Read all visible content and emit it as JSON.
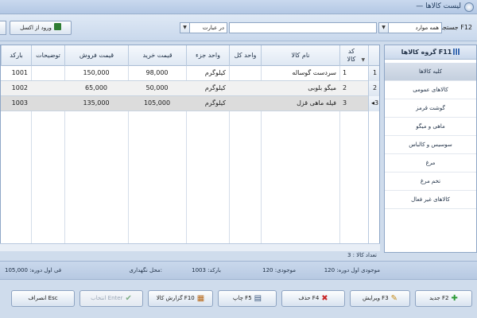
{
  "window": {
    "title": "— لیست کالاها"
  },
  "toolbar": {
    "search_label": "جستجو F12",
    "field_select": "همه موارد",
    "mode_select": "در عبارت",
    "search_value": "",
    "excel_button": "ورود از اکسل"
  },
  "grid": {
    "columns": {
      "code": "کد کالا",
      "name": "نام کالا",
      "unit_whole": "واحد کل",
      "unit_part": "واحد جزء",
      "buy_price": "قیمت خرید",
      "sell_price": "قیمت فروش",
      "description": "توضیحات",
      "barcode": "بارکد"
    },
    "rows": [
      {
        "index": "1",
        "code": "1",
        "name": "سردست گوساله",
        "unit_whole": "",
        "unit_part": "کیلوگرم",
        "buy_price": "98,000",
        "sell_price": "150,000",
        "description": "",
        "barcode": "1001"
      },
      {
        "index": "2",
        "code": "2",
        "name": "میگو بلوبی",
        "unit_whole": "",
        "unit_part": "کیلوگرم",
        "buy_price": "50,000",
        "sell_price": "65,000",
        "description": "",
        "barcode": "1002"
      },
      {
        "index": "◂3",
        "code": "3",
        "name": "فیله ماهی قزل",
        "unit_whole": "",
        "unit_part": "کیلوگرم",
        "buy_price": "105,000",
        "sell_price": "135,000",
        "description": "",
        "barcode": "1003"
      }
    ],
    "count_text": "تعداد کالا : 3"
  },
  "sidebar": {
    "title": "گروه کالاها F11",
    "items": [
      {
        "label": "کلیه کالاها"
      },
      {
        "label": "کالاهای عمومی"
      },
      {
        "label": "گوشت قرمز"
      },
      {
        "label": "ماهی و میگو"
      },
      {
        "label": "سوسیس و کالباس"
      },
      {
        "label": "مرغ"
      },
      {
        "label": "تخم مرغ"
      },
      {
        "label": "کالاهای غیر فعال"
      }
    ]
  },
  "infobar": {
    "stock_start": "موجودی اول دوره: 120",
    "stock": "موجودی: 120",
    "barcode": "بارکد: 1003",
    "location": "محل نگهداری:",
    "price_start": "فی اول دوره: 105,000"
  },
  "buttons": {
    "new": "جدید F2",
    "edit": "ویرایش F3",
    "delete": "حذف F4",
    "print": "چاپ F5",
    "report": "گزارش کالا F10",
    "select": "انتخاب Enter",
    "cancel": "انصراف Esc"
  }
}
